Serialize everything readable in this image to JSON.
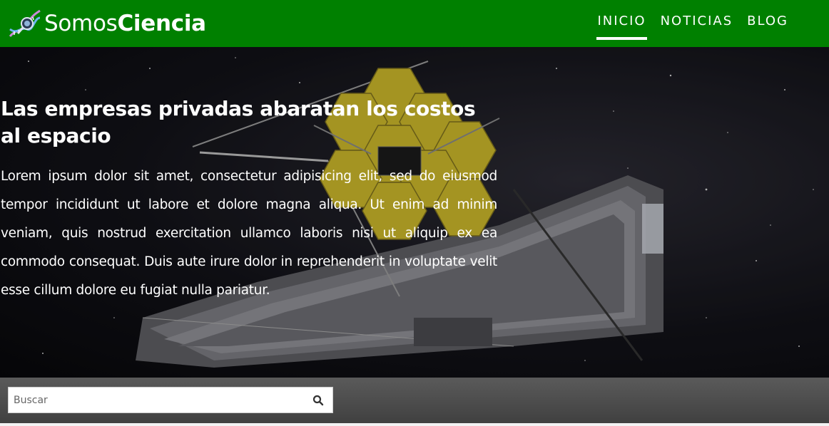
{
  "brand": {
    "name_light": "Somos",
    "name_bold": "Ciencia",
    "icon": "dna-microscope-logo-icon"
  },
  "nav": {
    "items": [
      {
        "label": "INICIO",
        "active": true
      },
      {
        "label": "NOTICIAS",
        "active": false
      },
      {
        "label": "BLOG",
        "active": false
      }
    ]
  },
  "hero": {
    "title": "Las empresas privadas abaratan los costos al espacio",
    "body": "Lorem ipsum dolor sit amet, consectetur adipisicing elit, sed do eiusmod tempor incididunt ut labore et dolore magna aliqua. Ut enim ad minim veniam, quis nostrud exercitation ullamco laboris nisi ut aliquip ex ea commodo consequat. Duis aute irure dolor in reprehenderit in voluptate velit esse cillum dolore eu fugiat nulla pariatur.",
    "image": "space-telescope-image"
  },
  "search": {
    "placeholder": "Buscar",
    "value": "",
    "icon": "search-icon"
  },
  "colors": {
    "header": "#008000",
    "nav_text": "#ffffff",
    "search_strip": "#4a4a4a"
  }
}
